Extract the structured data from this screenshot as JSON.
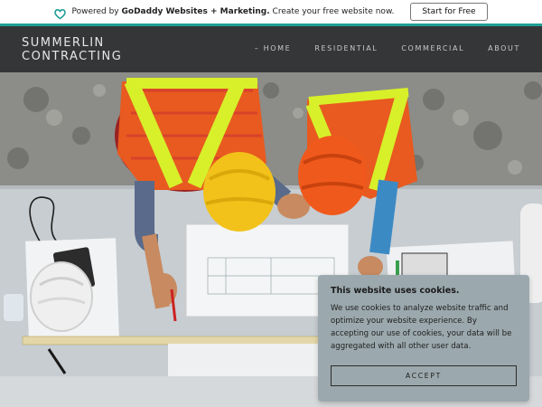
{
  "promo": {
    "powered_by": "Powered by",
    "product": "GoDaddy Websites + Marketing.",
    "tagline": "Create your free website now.",
    "cta_label": "Start for Free"
  },
  "header": {
    "brand_line1": "SUMMERLIN",
    "brand_line2": "CONTRACTING",
    "nav": [
      {
        "label": "– HOME"
      },
      {
        "label": "RESIDENTIAL"
      },
      {
        "label": "COMMERCIAL"
      },
      {
        "label": "ABOUT"
      }
    ]
  },
  "cookie": {
    "title": "This website uses cookies.",
    "body": "We use cookies to analyze website traffic and optimize your website experience. By accepting our use of cookies, your data will be aggregated with all other user data.",
    "accept_label": "ACCEPT"
  },
  "colors": {
    "accent": "#1f9e96",
    "header_bg": "#353637",
    "cookie_bg": "#9ba8ad"
  },
  "icons": {
    "promo": "godaddy-heart-icon"
  }
}
